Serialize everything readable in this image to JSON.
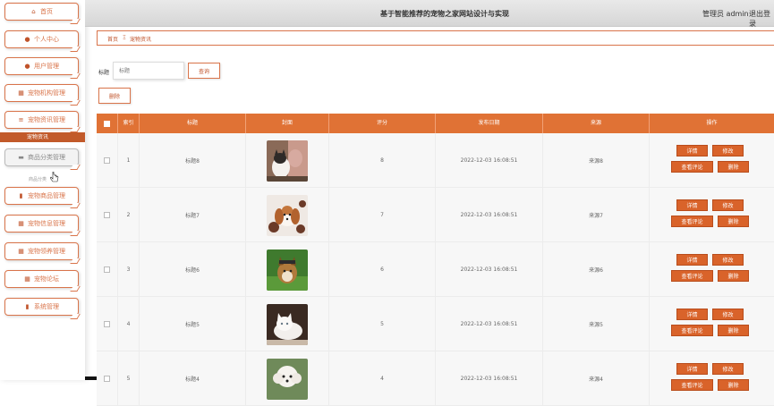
{
  "header": {
    "title": "基于智能推荐的宠物之家网站设计与实现",
    "admin": "管理员 admin",
    "logout": "退出登录"
  },
  "sidebar": {
    "items": [
      {
        "label": "首页",
        "icon": "home-icon",
        "glyph": "⌂"
      },
      {
        "label": "个人中心",
        "icon": "person-icon",
        "glyph": "●"
      },
      {
        "label": "用户管理",
        "icon": "user-icon",
        "glyph": "●"
      },
      {
        "label": "宠物机构管理",
        "icon": "gift-icon",
        "glyph": "▦"
      },
      {
        "label": "宠物资讯管理",
        "icon": "sliders-icon",
        "glyph": "≡"
      },
      {
        "label": "商品分类管理",
        "icon": "monitor-icon",
        "glyph": "▬"
      },
      {
        "label": "宠物商品管理",
        "icon": "bar-chart-icon",
        "glyph": "▮"
      },
      {
        "label": "宠物信息管理",
        "icon": "grid-icon",
        "glyph": "▦"
      },
      {
        "label": "宠物领养管理",
        "icon": "grid-icon",
        "glyph": "▦"
      },
      {
        "label": "宠物论坛",
        "icon": "grid-icon",
        "glyph": "▦"
      },
      {
        "label": "系统管理",
        "icon": "book-icon",
        "glyph": "▮"
      }
    ],
    "active_sub": "宠物资讯",
    "faint_sub": "商品分类"
  },
  "breadcrumb": {
    "home": "首页",
    "sep": "Ξ",
    "current": "宠物资讯"
  },
  "search": {
    "label": "标题",
    "placeholder": "标题",
    "button": "查询"
  },
  "toolbar": {
    "delete": "删除"
  },
  "table": {
    "columns": [
      "",
      "索引",
      "标题",
      "封面",
      "评分",
      "发布日期",
      "来源",
      "操作"
    ],
    "rows": [
      {
        "index": "1",
        "title": "标题8",
        "rating": "8",
        "date": "2022-12-03 16:08:51",
        "source": "来源8",
        "cover": "cat-with-dog"
      },
      {
        "index": "2",
        "title": "标题7",
        "rating": "7",
        "date": "2022-12-03 16:08:51",
        "source": "来源7",
        "cover": "puppy-spaniel"
      },
      {
        "index": "3",
        "title": "标题6",
        "rating": "6",
        "date": "2022-12-03 16:08:51",
        "source": "来源6",
        "cover": "dog-in-grass"
      },
      {
        "index": "4",
        "title": "标题5",
        "rating": "5",
        "date": "2022-12-03 16:08:51",
        "source": "来源5",
        "cover": "white-cat"
      },
      {
        "index": "5",
        "title": "标题4",
        "rating": "4",
        "date": "2022-12-03 16:08:51",
        "source": "来源4",
        "cover": "white-poodle"
      }
    ],
    "actions": {
      "detail": "详情",
      "edit": "修改",
      "comments": "查看评论",
      "delete": "删除"
    }
  },
  "colors": {
    "accent": "#e07235",
    "button": "#d9632a",
    "border": "#d9744a"
  }
}
